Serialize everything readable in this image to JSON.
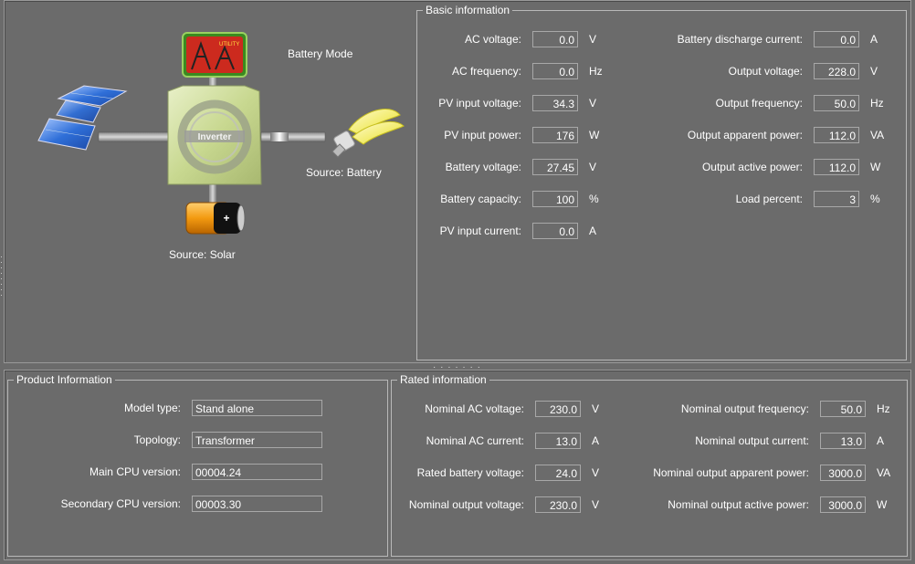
{
  "diagram": {
    "mode": "Battery Mode",
    "inverter_label": "Inverter",
    "utility_label": "UTILITY",
    "output_source": "Source:  Battery",
    "input_source": "Source:  Solar"
  },
  "basic": {
    "title": "Basic information",
    "left": [
      {
        "label": "AC voltage:",
        "value": "0.0",
        "unit": "V"
      },
      {
        "label": "AC frequency:",
        "value": "0.0",
        "unit": "Hz"
      },
      {
        "label": "PV input voltage:",
        "value": "34.3",
        "unit": "V"
      },
      {
        "label": "PV input power:",
        "value": "176",
        "unit": "W"
      },
      {
        "label": "Battery voltage:",
        "value": "27.45",
        "unit": "V"
      },
      {
        "label": "Battery capacity:",
        "value": "100",
        "unit": "%"
      },
      {
        "label": "PV input current:",
        "value": "0.0",
        "unit": "A"
      }
    ],
    "right": [
      {
        "label": "Battery discharge current:",
        "value": "0.0",
        "unit": "A"
      },
      {
        "label": "Output voltage:",
        "value": "228.0",
        "unit": "V"
      },
      {
        "label": "Output frequency:",
        "value": "50.0",
        "unit": "Hz"
      },
      {
        "label": "Output apparent power:",
        "value": "112.0",
        "unit": "VA"
      },
      {
        "label": "Output active power:",
        "value": "112.0",
        "unit": "W"
      },
      {
        "label": "Load percent:",
        "value": "3",
        "unit": "%"
      }
    ]
  },
  "product": {
    "title": "Product Information",
    "rows": [
      {
        "label": "Model type:",
        "value": "Stand alone"
      },
      {
        "label": "Topology:",
        "value": "Transformer"
      },
      {
        "label": "Main CPU version:",
        "value": "00004.24"
      },
      {
        "label": "Secondary CPU version:",
        "value": "00003.30"
      }
    ]
  },
  "rated": {
    "title": "Rated information",
    "left": [
      {
        "label": "Nominal AC voltage:",
        "value": "230.0",
        "unit": "V"
      },
      {
        "label": "Nominal AC current:",
        "value": "13.0",
        "unit": "A"
      },
      {
        "label": "Rated battery voltage:",
        "value": "24.0",
        "unit": "V"
      },
      {
        "label": "Nominal output voltage:",
        "value": "230.0",
        "unit": "V"
      }
    ],
    "right": [
      {
        "label": "Nominal output frequency:",
        "value": "50.0",
        "unit": "Hz"
      },
      {
        "label": "Nominal output current:",
        "value": "13.0",
        "unit": "A"
      },
      {
        "label": "Nominal output apparent power:",
        "value": "3000.0",
        "unit": "VA"
      },
      {
        "label": "Nominal output active power:",
        "value": "3000.0",
        "unit": "W"
      }
    ]
  }
}
